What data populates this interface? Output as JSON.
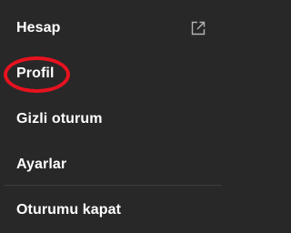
{
  "menu": {
    "items": [
      {
        "label": "Hesap",
        "icon": "external-link-icon"
      },
      {
        "label": "Profil"
      },
      {
        "label": "Gizli oturum"
      },
      {
        "label": "Ayarlar"
      },
      {
        "label": "Oturumu kapat"
      }
    ]
  },
  "colors": {
    "background": "#282828",
    "text": "#ffffff",
    "divider": "#3e3e3e",
    "annotation": "#e8121f"
  }
}
